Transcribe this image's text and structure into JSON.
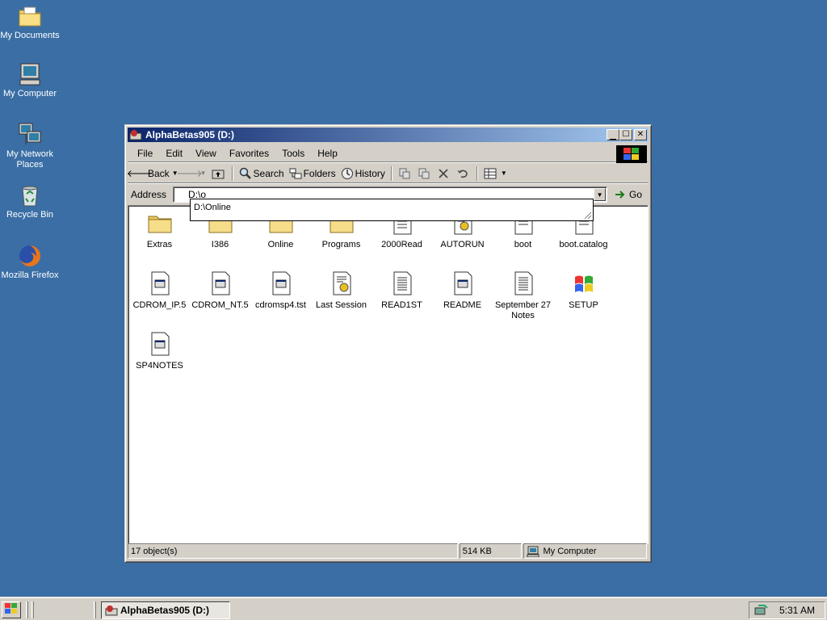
{
  "desktop": {
    "icons": [
      {
        "label": "My Documents",
        "icon": "folder-documents-icon"
      },
      {
        "label": "My Computer",
        "icon": "computer-icon"
      },
      {
        "label": "My Network Places",
        "icon": "network-icon"
      },
      {
        "label": "Recycle Bin",
        "icon": "recycle-bin-icon"
      },
      {
        "label": "Mozilla Firefox",
        "icon": "firefox-icon"
      }
    ]
  },
  "window": {
    "title": "AlphaBetas905 (D:)",
    "controls": {
      "minimize": "_",
      "maximize": "□",
      "close": "×"
    },
    "menu": [
      "File",
      "Edit",
      "View",
      "Favorites",
      "Tools",
      "Help"
    ],
    "toolbar": {
      "back": "Back",
      "search": "Search",
      "folders": "Folders",
      "history": "History"
    },
    "address": {
      "label": "Address",
      "value": "D:\\o",
      "go": "Go",
      "suggestion": "D:\\Online"
    },
    "files": [
      {
        "name": "Extras",
        "icon": "folder-icon"
      },
      {
        "name": "I386",
        "icon": "folder-icon"
      },
      {
        "name": "Online",
        "icon": "folder-icon"
      },
      {
        "name": "Programs",
        "icon": "folder-icon"
      },
      {
        "name": "2000Read",
        "icon": "document-icon"
      },
      {
        "name": "AUTORUN",
        "icon": "settings-file-icon"
      },
      {
        "name": "boot",
        "icon": "document-icon"
      },
      {
        "name": "boot.catalog",
        "icon": "document-icon"
      },
      {
        "name": "CDROM_IP.5",
        "icon": "file-icon"
      },
      {
        "name": "CDROM_NT.5",
        "icon": "file-icon"
      },
      {
        "name": "cdromsp4.tst",
        "icon": "file-icon"
      },
      {
        "name": "Last Session",
        "icon": "settings-file-icon"
      },
      {
        "name": "READ1ST",
        "icon": "text-document-icon"
      },
      {
        "name": "README",
        "icon": "file-icon"
      },
      {
        "name": "September 27 Notes",
        "icon": "text-document-icon"
      },
      {
        "name": "SETUP",
        "icon": "windows-setup-icon"
      },
      {
        "name": "SP4NOTES",
        "icon": "file-icon"
      }
    ],
    "status": {
      "objects": "17 object(s)",
      "size": "514 KB",
      "location": "My Computer"
    }
  },
  "taskbar": {
    "task": "AlphaBetas905 (D:)",
    "clock": "5:31 AM"
  }
}
